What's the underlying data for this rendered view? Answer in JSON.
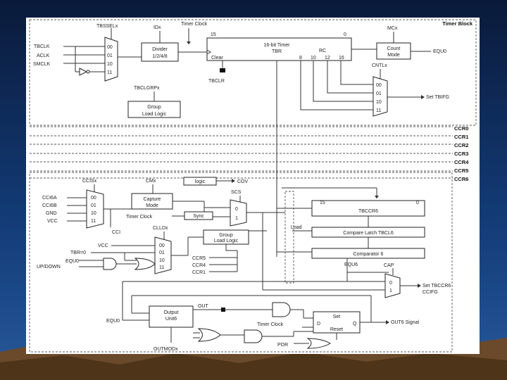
{
  "slide": {
    "background_top": "#0a1a3a",
    "background_mid": "#1c4a8a",
    "ground": "#6a4a2a"
  },
  "diagram": {
    "title": "Timer Block",
    "top": {
      "tbssel": "TBSSELx",
      "idx": "IDx",
      "timer_clock": "Timer Clock",
      "bit15": "15",
      "bit0": "0",
      "mcx": "MCx",
      "inputs": [
        "TBCLK",
        "ACLK",
        "SMCLK"
      ],
      "mux_codes": [
        "00",
        "01",
        "10",
        "11"
      ],
      "divider_1": "Divider",
      "divider_2": "1/2/4/8",
      "timer_1": "16-bit Timer",
      "timer_2": "TBR",
      "clear": "Clear",
      "rc": "RC",
      "rc_bits": [
        "8",
        "10",
        "12",
        "16"
      ],
      "count_1": "Count",
      "count_2": "Mode",
      "equ0": "EQU0",
      "tbclr": "TBCLR",
      "cntlx": "CNTLx",
      "set_tbifg": "Set TBIFG",
      "tbclgrp": "TBCLGRPx",
      "group_1": "Group",
      "group_2": "Load Logic"
    },
    "ccr_labels": [
      "CCR0",
      "CCR1",
      "CCR2",
      "CCR3",
      "CCR4",
      "CCR5",
      "CCR6"
    ],
    "bottom": {
      "ccis": "CCISx",
      "ccis_inputs": [
        "CCI6A",
        "CCI6B",
        "GND",
        "VCC"
      ],
      "ccis_codes": [
        "00",
        "01",
        "10",
        "11"
      ],
      "cci": "CCI",
      "cmx": "CMx",
      "capture_1": "Capture",
      "capture_2": "Mode",
      "logic": "logic",
      "cov": "COV",
      "scs": "SCS",
      "sync": "Sync",
      "timer_clock": "Timer Clock",
      "scs_codes": [
        "0",
        "1"
      ],
      "tbccr6": "TBCCR6",
      "bit15": "15",
      "bit0": "0",
      "load": "Load",
      "latch": "Compare Latch TBCL6",
      "comparator": "Comparator 6",
      "equ6": "EQU6",
      "clld": "CLLDx",
      "clld_inputs": [
        "VCC",
        "TBR=0",
        "EQU0",
        "UP/DOWN"
      ],
      "clld_codes": [
        "00",
        "01",
        "10",
        "11"
      ],
      "grp_1": "Group",
      "grp_2": "Load Logic",
      "ccr_refs": [
        "CCR5",
        "CCR4",
        "CCR1"
      ],
      "cap": "CAP",
      "cap_codes": [
        "0",
        "1"
      ],
      "set_ccifg_1": "Set TBCCR6",
      "set_ccifg_2": "CCIFG",
      "out_1": "Output",
      "out_2": "Unit6",
      "out": "OUT",
      "equ0": "EQU0",
      "set": "Set",
      "d": "D",
      "q": "Q",
      "reset": "Reset",
      "timer_clock2": "Timer Clock",
      "out6": "OUT6 Signal",
      "por": "POR",
      "outmod": "OUTMODx"
    }
  }
}
